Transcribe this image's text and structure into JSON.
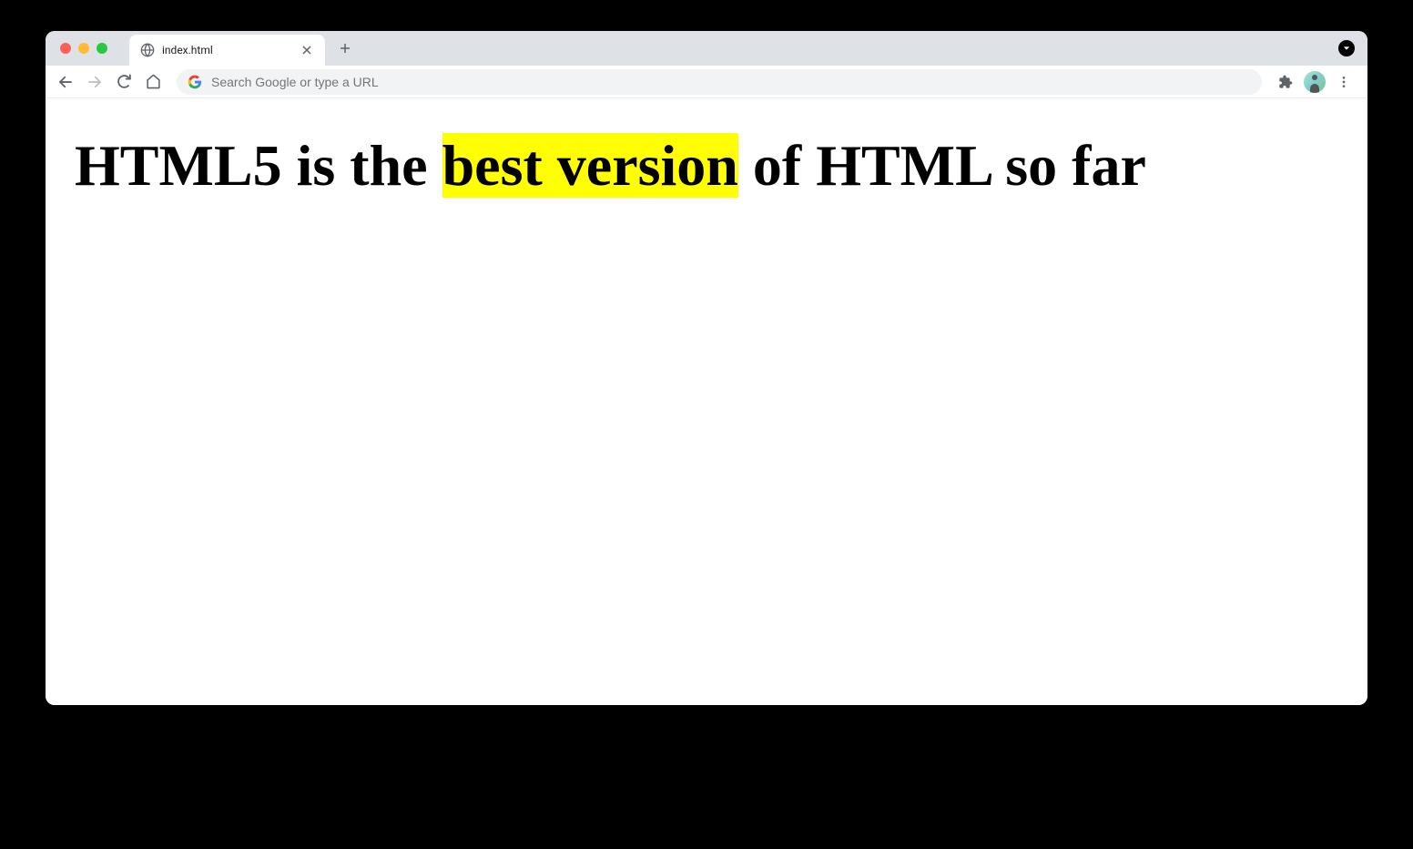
{
  "browser": {
    "tab": {
      "title": "index.html"
    },
    "omnibox": {
      "placeholder": "Search Google or type a URL"
    }
  },
  "page": {
    "heading": {
      "before": "HTML5 is the ",
      "highlight": "best version",
      "after": " of HTML so far"
    }
  }
}
